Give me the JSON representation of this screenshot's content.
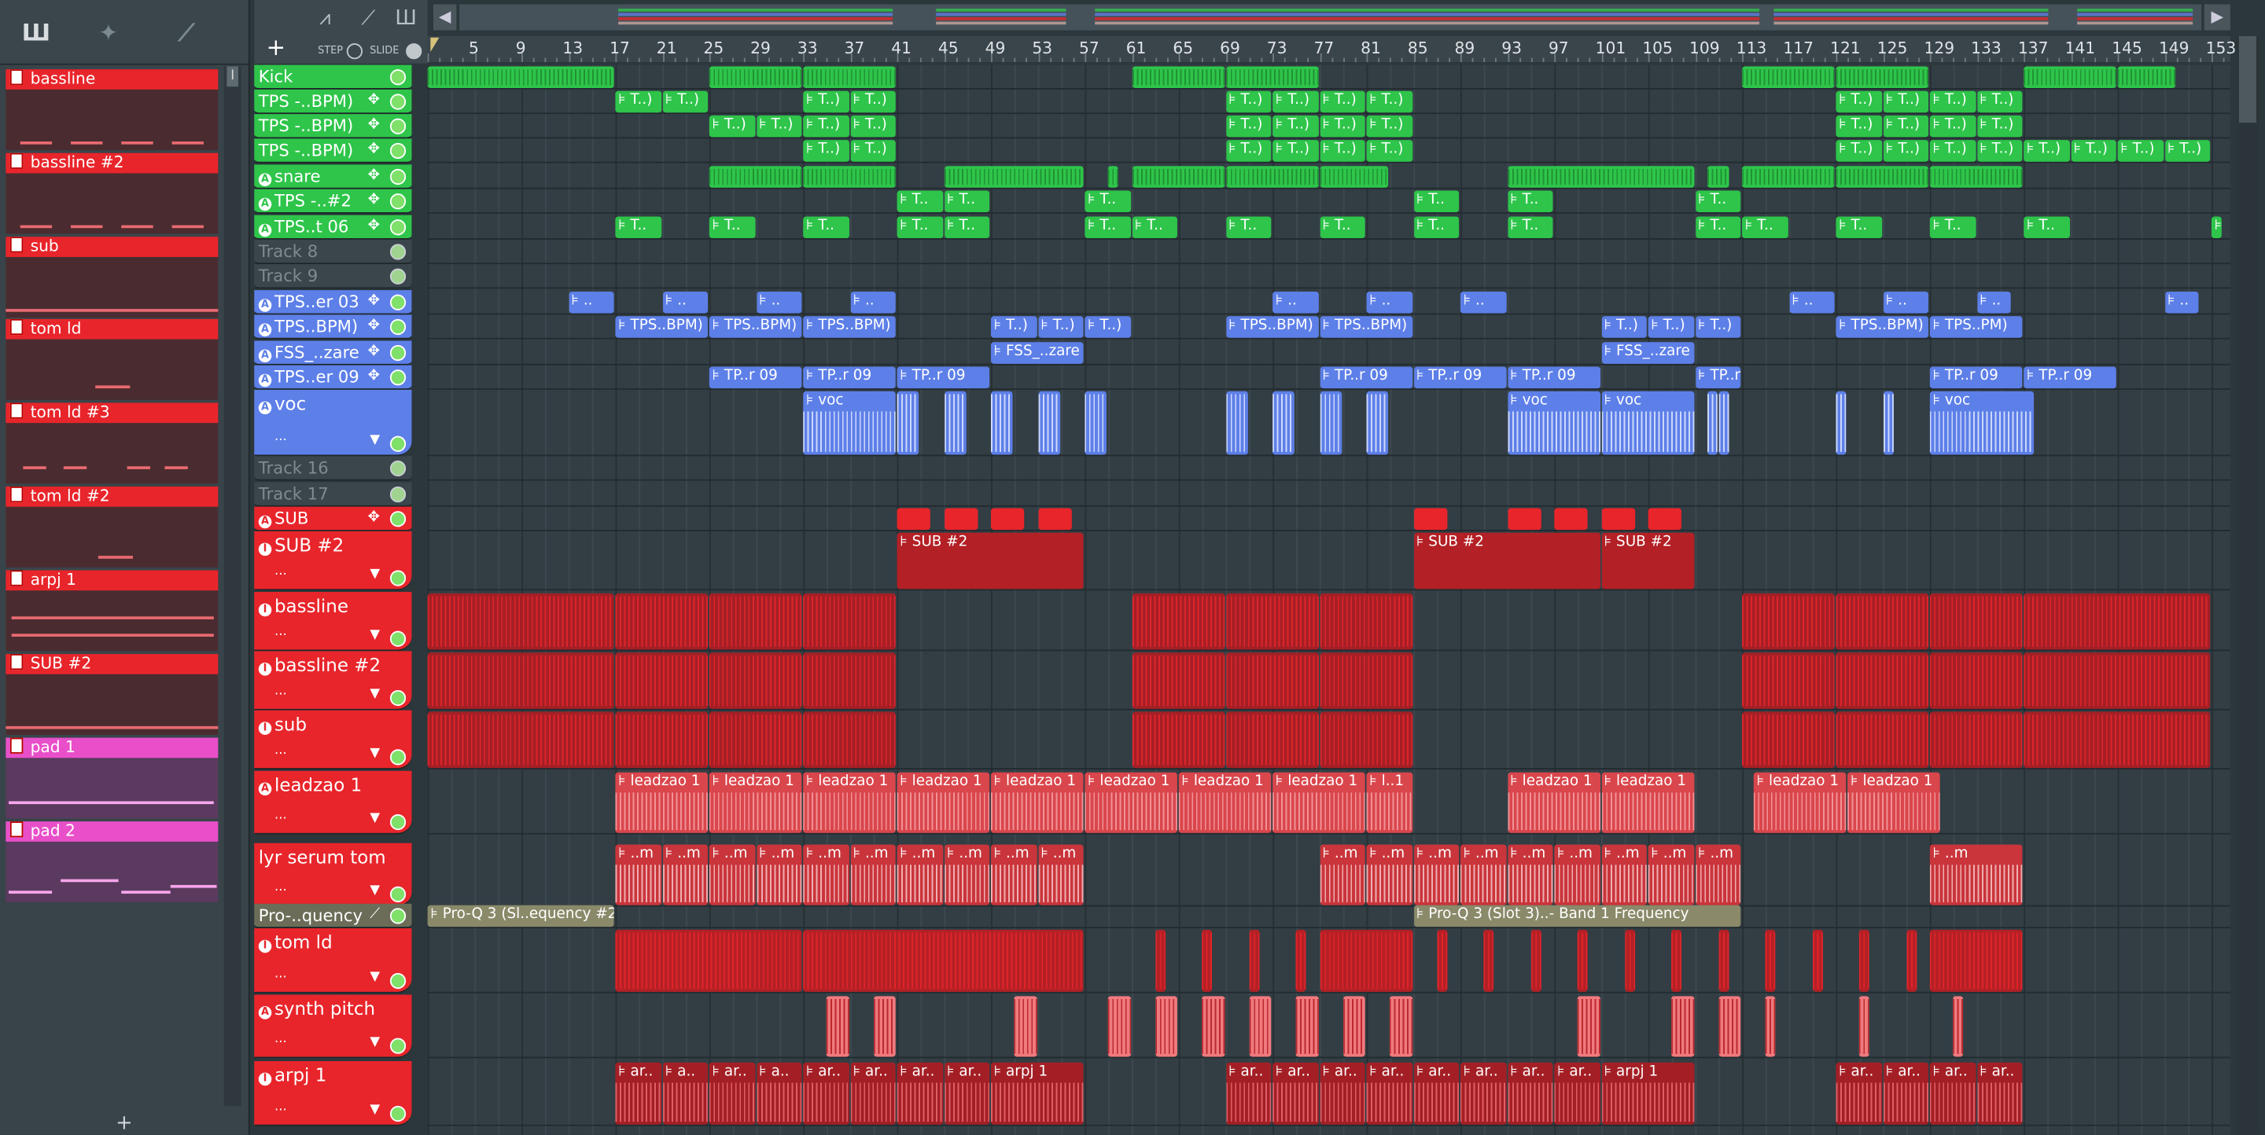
{
  "picker": {
    "items": [
      {
        "label": "bassline",
        "color": "#e8252b"
      },
      {
        "label": "bassline  #2",
        "color": "#e8252b"
      },
      {
        "label": "sub",
        "color": "#e8252b"
      },
      {
        "label": "tom ld",
        "color": "#e8252b"
      },
      {
        "label": "tom ld #3",
        "color": "#e8252b"
      },
      {
        "label": "tom ld #2",
        "color": "#e8252b"
      },
      {
        "label": "arpj 1",
        "color": "#e8252b"
      },
      {
        "label": "SUB #2",
        "color": "#e8252b"
      },
      {
        "label": "pad 1",
        "color": "#e84fc9"
      },
      {
        "label": "pad 2",
        "color": "#e84fc9"
      }
    ],
    "scroll_glyph": "I",
    "add_label": "+"
  },
  "toolbar": {
    "add_label": "+",
    "step_label": "STEP",
    "slide_label": "SLIDE",
    "icons": [
      "waveform-icon",
      "stamp-icon",
      "slide-icon"
    ],
    "nav_left": "◀",
    "nav_right": "▶"
  },
  "ruler": {
    "bars": [
      "5",
      "9",
      "13",
      "17",
      "21",
      "25",
      "29",
      "33",
      "37",
      "41",
      "45",
      "49",
      "53",
      "57",
      "61",
      "65",
      "69",
      "73",
      "77",
      "81",
      "85",
      "89",
      "93",
      "97",
      "101",
      "105",
      "109",
      "113",
      "117",
      "121",
      "125",
      "129",
      "133",
      "137",
      "141",
      "145",
      "149",
      "153"
    ]
  },
  "tracks": [
    {
      "name": "Kick",
      "type": "audio",
      "color": "#2ec54a",
      "active": true,
      "dot": ""
    },
    {
      "name": "TPS -..BPM)",
      "type": "audio",
      "color": "#2ec54a",
      "active": true,
      "dot": ""
    },
    {
      "name": "TPS -..BPM)",
      "type": "audio",
      "color": "#2ec54a",
      "active": true,
      "dot": ""
    },
    {
      "name": "TPS -..BPM)",
      "type": "audio",
      "color": "#2ec54a",
      "active": true,
      "dot": ""
    },
    {
      "name": "snare",
      "type": "audio",
      "color": "#2ec54a",
      "active": true,
      "dot": "A"
    },
    {
      "name": "TPS -..#2",
      "type": "audio",
      "color": "#2ec54a",
      "active": true,
      "dot": "A"
    },
    {
      "name": "TPS..t 06",
      "type": "audio",
      "color": "#2ec54a",
      "active": true,
      "dot": "A"
    },
    {
      "name": "Track 8",
      "type": "empty",
      "active": false,
      "dot": ""
    },
    {
      "name": "Track 9",
      "type": "empty",
      "active": false,
      "dot": ""
    },
    {
      "name": "TPS..er 03",
      "type": "audio",
      "color": "#5d7fe8",
      "active": true,
      "dot": "A"
    },
    {
      "name": "TPS..BPM)",
      "type": "audio",
      "color": "#5d7fe8",
      "active": true,
      "dot": "A"
    },
    {
      "name": "FSS_..zare",
      "type": "audio",
      "color": "#5d7fe8",
      "active": true,
      "dot": "A"
    },
    {
      "name": "TPS..er 09",
      "type": "audio",
      "color": "#5d7fe8",
      "active": true,
      "dot": "A"
    },
    {
      "name": "voc",
      "type": "audio",
      "color": "#5d7fe8",
      "active": true,
      "dot": "A"
    },
    {
      "name": "Track 16",
      "type": "empty",
      "active": false,
      "dot": ""
    },
    {
      "name": "Track 17",
      "type": "empty",
      "active": false,
      "dot": ""
    },
    {
      "name": "SUB",
      "type": "audio",
      "color": "#e8252b",
      "active": true,
      "dot": "A"
    },
    {
      "name": "SUB #2",
      "type": "pattern",
      "color": "#e8252b",
      "active": true,
      "dot": "I"
    },
    {
      "name": "bassline",
      "type": "pattern",
      "color": "#e8252b",
      "active": true,
      "dot": "I"
    },
    {
      "name": "bassline  #2",
      "type": "pattern",
      "color": "#e8252b",
      "active": true,
      "dot": "I"
    },
    {
      "name": "sub",
      "type": "pattern",
      "color": "#e8252b",
      "active": true,
      "dot": "I"
    },
    {
      "name": "leadzao 1",
      "type": "audio",
      "color": "#e8252b",
      "active": true,
      "dot": "A"
    },
    {
      "name": "lyr serum tom",
      "type": "audio",
      "color": "#e8252b",
      "active": true,
      "dot": ""
    },
    {
      "name": "Pro-..quency",
      "type": "automation",
      "color": "#6f7060",
      "active": true,
      "dot": ""
    },
    {
      "name": "tom ld",
      "type": "pattern",
      "color": "#e8252b",
      "active": true,
      "dot": "I"
    },
    {
      "name": "synth pitch",
      "type": "audio",
      "color": "#e8252b",
      "active": true,
      "dot": "A"
    },
    {
      "name": "arpj 1",
      "type": "pattern",
      "color": "#e8252b",
      "active": true,
      "dot": "I"
    }
  ],
  "clip_labels": {
    "tps_bpm": "T..)",
    "tps2": "T..",
    "tps06": "T..",
    "er03": "..",
    "tps_bpm_blue": "TPS..BPM)",
    "tps_pm_blue": "TPS..PM)",
    "fss": "FSS_..zare",
    "er09": "TP..r 09",
    "voc": "voc",
    "sub2": "SUB #2",
    "leadzao": "leadzao 1",
    "lead_short": "l..1",
    "lyr": "..m",
    "proq_a": "Pro-Q 3 (Sl..equency #2",
    "proq_b": "Pro-Q 3 (Slot 3)..- Band 1 Frequency",
    "arpj": "arpj 1",
    "arpj_short": "ar..",
    "arpj_a": "a.."
  },
  "colors": {
    "green": "#2ec54a",
    "blue": "#5d7fe8",
    "red": "#e8252b",
    "pink": "#e84fc9",
    "automation": "#6f7060"
  }
}
